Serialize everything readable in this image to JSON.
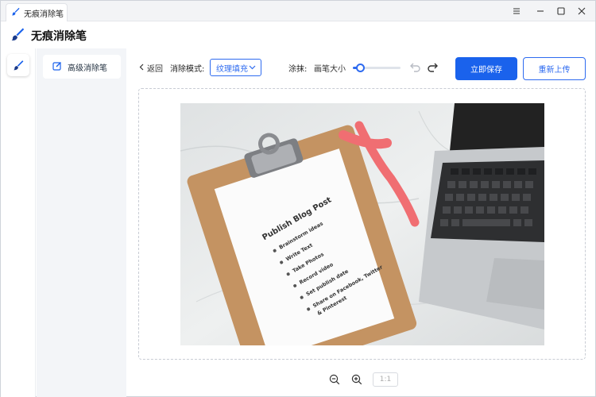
{
  "window": {
    "tab_title": "无痕消除笔"
  },
  "header": {
    "app_title": "无痕消除笔"
  },
  "sidebar": {
    "items": [
      {
        "label": "高级消除笔",
        "icon": "edit-icon",
        "active": true
      }
    ]
  },
  "toolbar": {
    "back_label": "返回",
    "mode_label": "消除模式:",
    "mode_value": "纹理填充",
    "smear_label": "涂抹:",
    "brush_size_label": "画笔大小",
    "brush_size_level": 0.08,
    "save_label": "立即保存",
    "reupload_label": "重新上传"
  },
  "image": {
    "clipboard_lines": [
      "Publish Blog Post",
      "Brainstorm ideas",
      "Write Text",
      "Take Photos",
      "Record video",
      "Set publish date",
      "Share on Facebook, Twitter",
      "& Pinterest"
    ]
  },
  "zoom": {
    "ratio_label": "1:1"
  },
  "colors": {
    "accent": "#1a62ec",
    "sidebar_bg": "#f3f5f8"
  }
}
